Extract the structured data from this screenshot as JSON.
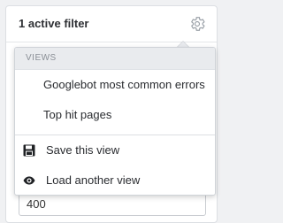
{
  "panel": {
    "title": "1 active filter",
    "gear_icon": "gear-icon",
    "value_input": "400"
  },
  "views_menu": {
    "section_header": "VIEWS",
    "views": [
      {
        "label": "Googlebot most common errors"
      },
      {
        "label": "Top hit pages"
      }
    ],
    "actions": [
      {
        "label": "Save this view",
        "icon": "floppy-disk-icon"
      },
      {
        "label": "Load another view",
        "icon": "eye-icon"
      }
    ]
  }
}
